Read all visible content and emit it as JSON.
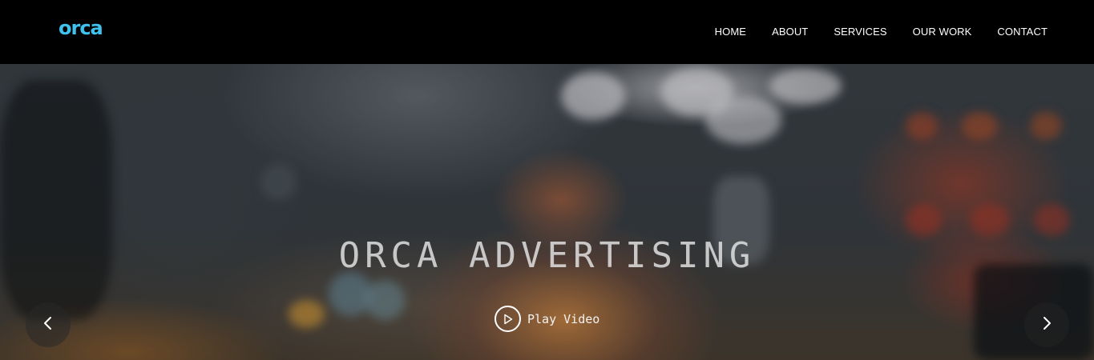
{
  "brand": {
    "logo_text": "orca",
    "accent_color": "#3fc3ee"
  },
  "nav": {
    "items": [
      {
        "label": "HOME"
      },
      {
        "label": "ABOUT"
      },
      {
        "label": "SERVICES"
      },
      {
        "label": "OUR WORK"
      },
      {
        "label": "CONTACT"
      }
    ]
  },
  "hero": {
    "title": "ORCA ADVERTISING",
    "play_label": "Play Video",
    "play_icon": "play-icon",
    "prev_icon": "chevron-left-icon",
    "next_icon": "chevron-right-icon"
  }
}
